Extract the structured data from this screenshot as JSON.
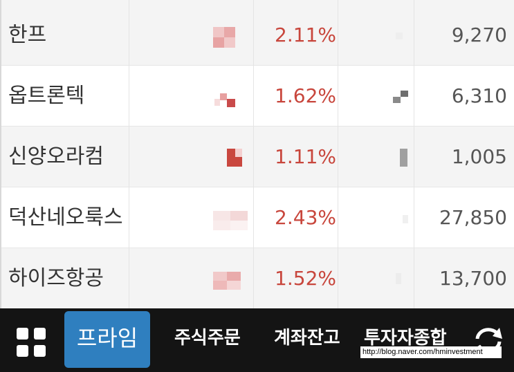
{
  "stocks": [
    {
      "name": "한프",
      "change": "2.11%",
      "price": "9,270"
    },
    {
      "name": "옵트론텍",
      "change": "1.62%",
      "price": "6,310"
    },
    {
      "name": "신양오라컴",
      "change": "1.11%",
      "price": "1,005"
    },
    {
      "name": "덕산네오룩스",
      "change": "2.43%",
      "price": "27,850"
    },
    {
      "name": "하이즈항공",
      "change": "1.52%",
      "price": "13,700"
    }
  ],
  "nav": {
    "active": "프라임",
    "items": [
      "주식주문",
      "계좌잔고",
      "투자자종합"
    ]
  },
  "watermark": "http://blog.naver.com/hminvestment",
  "colors": {
    "up": "#c8463c",
    "bar": "#141414",
    "active": "#2f7fbf"
  }
}
